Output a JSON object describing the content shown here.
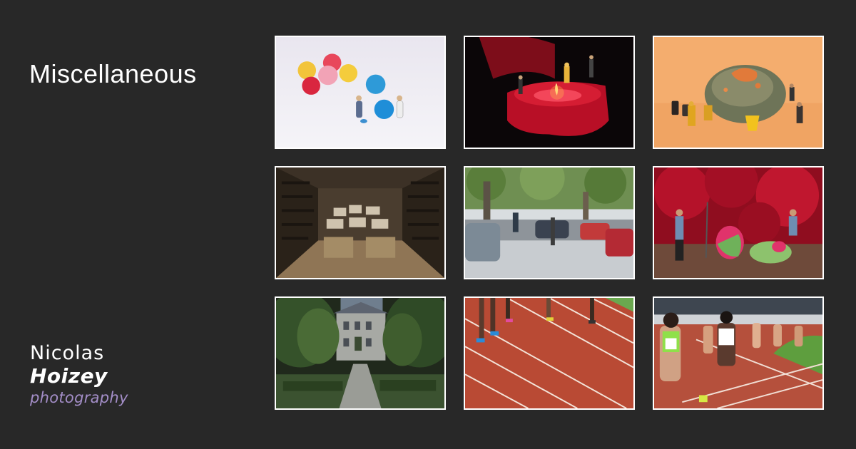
{
  "gallery": {
    "title": "Miscellaneous"
  },
  "logo": {
    "line1": "Nicolas",
    "line2": "Hoizey",
    "line3": "photography",
    "accent_color": "#a48ec8"
  },
  "colors": {
    "background": "#282828",
    "thumb_border": "#ffffff"
  },
  "photos": [
    {
      "subject": "miniature-figures-with-candies"
    },
    {
      "subject": "miniature-figures-on-red-candle"
    },
    {
      "subject": "miniature-figures-with-moldy-bread"
    },
    {
      "subject": "miniature-wine-cellar"
    },
    {
      "subject": "tilt-shift-street-scene"
    },
    {
      "subject": "miniature-figures-with-rose-buds"
    },
    {
      "subject": "chateau-with-topiary"
    },
    {
      "subject": "runners-legs-on-track"
    },
    {
      "subject": "women-running-race"
    }
  ]
}
